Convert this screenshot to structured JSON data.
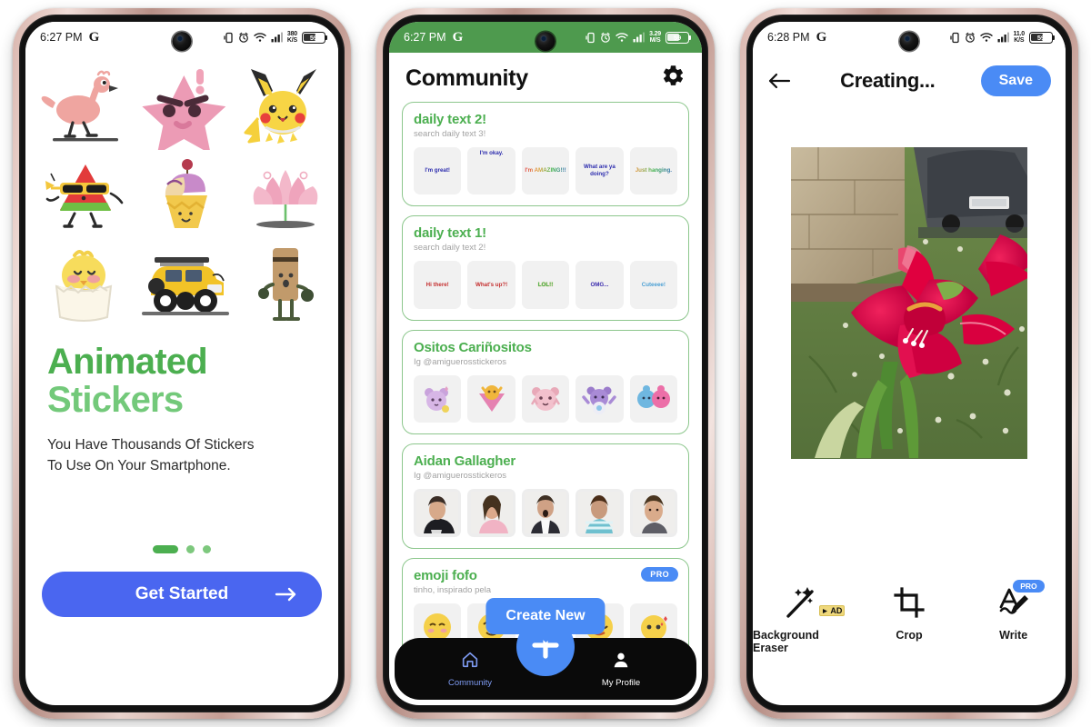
{
  "phone1": {
    "status": {
      "time": "6:27 PM",
      "brand": "G",
      "netspeed_value": "380",
      "netspeed_unit": "K/S",
      "battery": "59"
    },
    "stickers": [
      "flamingo",
      "angry-star",
      "pikachu",
      "watermelon-sunglasses",
      "ice-cream-cone",
      "lotus-flower",
      "hatching-chick",
      "yellow-offroad-truck",
      "chocolate-bar-character"
    ],
    "title_line1": "Animated",
    "title_line2": "Stickers",
    "subtitle": "You Have Thousands Of Stickers\nTo Use On Your Smartphone.",
    "dots": {
      "total": 3,
      "active_index": 0
    },
    "cta_label": "Get Started",
    "colors": {
      "title_primary": "#4CAF50",
      "title_secondary": "#73C97A",
      "cta": "#4A66F0"
    }
  },
  "phone2": {
    "status": {
      "time": "6:27 PM",
      "brand": "G",
      "netspeed_value": "3.29",
      "netspeed_unit": "M/S",
      "battery": "59",
      "bar_color": "#4e9a4e"
    },
    "header": {
      "title": "Community",
      "settings_icon": "gear-icon"
    },
    "packs": [
      {
        "name": "daily text 2!",
        "sub": "search daily text 3!",
        "pro": false,
        "stickers": [
          "I'm great!",
          "I'm okay.",
          "I'm AMAZING!!!",
          "What are ya doing?",
          "Just hanging."
        ]
      },
      {
        "name": "daily text 1!",
        "sub": "search daily text 2!",
        "pro": false,
        "stickers": [
          "Hi there!",
          "What's up?!",
          "LOL!!",
          "OMG...",
          "Cuteeee!"
        ]
      },
      {
        "name": "Ositos Cariñositos",
        "sub": "Ig @amiguerosstickeros",
        "pro": false,
        "stickers": [
          "care-bear-purple",
          "care-bear-orange",
          "care-bear-pink",
          "care-bear-violet",
          "care-bears-pair"
        ]
      },
      {
        "name": "Aidan Gallagher",
        "sub": "Ig @amiguerosstickeros",
        "pro": false,
        "stickers": [
          "photo-1",
          "photo-2",
          "photo-3",
          "photo-4",
          "photo-5"
        ]
      },
      {
        "name": "emoji fofo",
        "sub": "tinho, inspirado pela",
        "pro": true,
        "pro_label": "PRO",
        "stickers": [
          "emoji-1",
          "emoji-2",
          "emoji-3",
          "emoji-4",
          "emoji-5"
        ]
      }
    ],
    "tooltip": "Create New",
    "nav": [
      {
        "label": "Community",
        "icon": "home-icon",
        "active": true
      },
      {
        "label": "My Profile",
        "icon": "person-icon",
        "active": false
      }
    ],
    "fab_icon": "plus-icon",
    "colors": {
      "accent_green": "#4CAF50",
      "card_border": "#8dc78d",
      "blue": "#4A8BF5",
      "nav_bg": "#0a0a0a"
    }
  },
  "phone3": {
    "status": {
      "time": "6:28 PM",
      "brand": "G",
      "netspeed_value": "11.0",
      "netspeed_unit": "K/S",
      "battery": "59"
    },
    "header": {
      "back_icon": "arrow-left-icon",
      "title": "Creating...",
      "save_label": "Save"
    },
    "canvas": {
      "content": "red-amaryllis-flower-photo",
      "background": "transparency-checkerboard"
    },
    "tools": [
      {
        "label": "Background Eraser",
        "icon": "magic-wand-icon",
        "ad_label": "AD",
        "ad": true,
        "pro": false
      },
      {
        "label": "Crop",
        "icon": "crop-icon",
        "ad": false,
        "pro": false
      },
      {
        "label": "Write",
        "icon": "write-pen-icon",
        "ad": false,
        "pro": true,
        "pro_label": "PRO"
      }
    ],
    "colors": {
      "save_button": "#4A8BF5",
      "pro_badge": "#4A8BF5",
      "ad_chip": "#EFD87C"
    }
  }
}
